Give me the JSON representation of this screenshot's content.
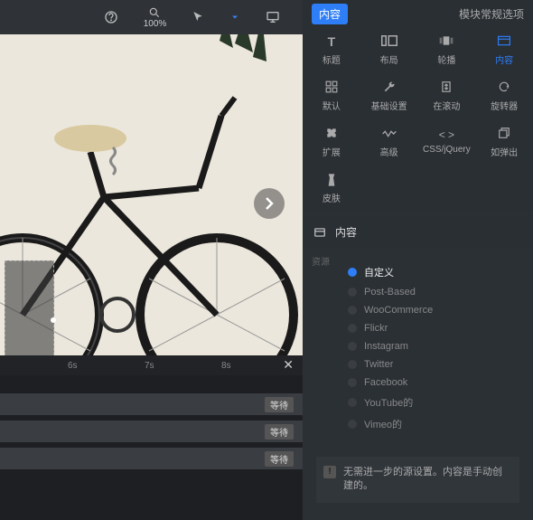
{
  "toolbar": {
    "zoom_label": "100%"
  },
  "timeline": {
    "marks": [
      "6s",
      "7s",
      "8s"
    ],
    "track_badge": "等待"
  },
  "right_panel": {
    "title_pill": "内容",
    "subtitle": "模块常规选项",
    "tabs": [
      {
        "label": "标题",
        "icon": "T"
      },
      {
        "label": "布局",
        "icon": "layout"
      },
      {
        "label": "轮播",
        "icon": "carousel"
      },
      {
        "label": "内容",
        "icon": "content",
        "active": true
      },
      {
        "label": "默认",
        "icon": "grid"
      },
      {
        "label": "基础设置",
        "icon": "wrench"
      },
      {
        "label": "在滚动",
        "icon": "scroll"
      },
      {
        "label": "旋转器",
        "icon": "spinner"
      },
      {
        "label": "扩展",
        "icon": "puzzle"
      },
      {
        "label": "高级",
        "icon": "wave"
      },
      {
        "label": "CSS/jQuery",
        "icon": "code"
      },
      {
        "label": "如弹出",
        "icon": "popup"
      },
      {
        "label": "皮肤",
        "icon": "skin"
      }
    ],
    "section_title": "内容",
    "source_label": "资源",
    "options": [
      {
        "label": "自定义",
        "selected": true
      },
      {
        "label": "Post-Based"
      },
      {
        "label": "WooCommerce"
      },
      {
        "label": "Flickr"
      },
      {
        "label": "Instagram"
      },
      {
        "label": "Twitter"
      },
      {
        "label": "Facebook"
      },
      {
        "label": "YouTube的"
      },
      {
        "label": "Vimeo的"
      }
    ],
    "info_text": "无需进一步的源设置。内容是手动创建的。"
  }
}
